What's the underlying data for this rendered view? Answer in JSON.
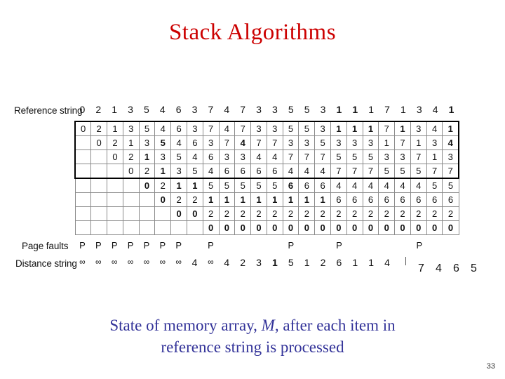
{
  "slide": {
    "title": "Stack Algorithms",
    "page_number": "33",
    "title_color": "#cc0000",
    "caption_color": "#333399"
  },
  "labels": {
    "reference_string": "Reference string",
    "page_faults": "Page faults",
    "distance_string": "Distance string"
  },
  "caption": {
    "line1_part1": "State of memory array, ",
    "line1_italic": "M",
    "line1_part2": ", after each item in",
    "line2": "reference string is processed"
  },
  "chart_data": {
    "type": "table",
    "title": "State of memory array, M, after each item in reference string is processed",
    "columns": 24,
    "reference_string": [
      "0",
      "2",
      "1",
      "3",
      "5",
      "4",
      "6",
      "3",
      "7",
      "4",
      "7",
      "3",
      "3",
      "5",
      "5",
      "3",
      "1",
      "1",
      "1",
      "7",
      "1",
      "3",
      "4",
      "1"
    ],
    "reference_string_bold": [
      false,
      false,
      false,
      false,
      false,
      false,
      false,
      false,
      false,
      false,
      false,
      false,
      false,
      false,
      false,
      false,
      true,
      true,
      false,
      false,
      false,
      false,
      false,
      true
    ],
    "matrix_rows": [
      [
        "0",
        "2",
        "1",
        "3",
        "5",
        "4",
        "6",
        "3",
        "7",
        "4",
        "7",
        "3",
        "3",
        "5",
        "5",
        "3",
        "1",
        "1",
        "1",
        "7",
        "1",
        "3",
        "4",
        "1"
      ],
      [
        "",
        "0",
        "2",
        "1",
        "3",
        "5",
        "4",
        "6",
        "3",
        "7",
        "4",
        "7",
        "7",
        "3",
        "3",
        "5",
        "3",
        "3",
        "3",
        "1",
        "7",
        "1",
        "3",
        "4"
      ],
      [
        "",
        "",
        "0",
        "2",
        "1",
        "3",
        "5",
        "4",
        "6",
        "3",
        "3",
        "4",
        "4",
        "7",
        "7",
        "7",
        "5",
        "5",
        "5",
        "3",
        "3",
        "7",
        "1",
        "3"
      ],
      [
        "",
        "",
        "",
        "0",
        "2",
        "1",
        "3",
        "5",
        "4",
        "6",
        "6",
        "6",
        "6",
        "4",
        "4",
        "4",
        "7",
        "7",
        "7",
        "5",
        "5",
        "5",
        "7",
        "7"
      ],
      [
        "",
        "",
        "",
        "",
        "0",
        "2",
        "1",
        "1",
        "5",
        "5",
        "5",
        "5",
        "5",
        "6",
        "6",
        "6",
        "4",
        "4",
        "4",
        "4",
        "4",
        "4",
        "5",
        "5"
      ],
      [
        "",
        "",
        "",
        "",
        "",
        "0",
        "2",
        "2",
        "1",
        "1",
        "1",
        "1",
        "1",
        "1",
        "1",
        "1",
        "6",
        "6",
        "6",
        "6",
        "6",
        "6",
        "6",
        "6"
      ],
      [
        "",
        "",
        "",
        "",
        "",
        "",
        "0",
        "0",
        "2",
        "2",
        "2",
        "2",
        "2",
        "2",
        "2",
        "2",
        "2",
        "2",
        "2",
        "2",
        "2",
        "2",
        "2",
        "2"
      ],
      [
        "",
        "",
        "",
        "",
        "",
        "",
        "",
        "",
        "0",
        "0",
        "0",
        "0",
        "0",
        "0",
        "0",
        "0",
        "0",
        "0",
        "0",
        "0",
        "0",
        "0",
        "0",
        "0"
      ]
    ],
    "matrix_bold": [
      [
        false,
        false,
        false,
        false,
        false,
        false,
        false,
        false,
        false,
        false,
        false,
        false,
        false,
        false,
        false,
        false,
        true,
        true,
        true,
        false,
        true,
        false,
        false,
        true
      ],
      [
        false,
        false,
        false,
        false,
        false,
        true,
        false,
        false,
        false,
        false,
        true,
        false,
        false,
        false,
        false,
        false,
        false,
        false,
        false,
        false,
        false,
        false,
        false,
        true
      ],
      [
        false,
        false,
        false,
        false,
        true,
        false,
        false,
        false,
        false,
        false,
        false,
        false,
        false,
        false,
        false,
        false,
        false,
        false,
        false,
        false,
        false,
        false,
        false,
        false
      ],
      [
        false,
        false,
        false,
        false,
        false,
        true,
        false,
        false,
        false,
        false,
        false,
        false,
        false,
        false,
        false,
        false,
        false,
        false,
        false,
        false,
        false,
        false,
        false,
        false
      ],
      [
        false,
        false,
        false,
        false,
        true,
        false,
        true,
        true,
        false,
        false,
        false,
        false,
        false,
        true,
        false,
        false,
        false,
        false,
        false,
        false,
        false,
        false,
        false,
        false
      ],
      [
        false,
        false,
        false,
        false,
        false,
        true,
        false,
        false,
        true,
        true,
        true,
        true,
        true,
        true,
        true,
        true,
        false,
        false,
        false,
        false,
        false,
        false,
        false,
        false
      ],
      [
        false,
        false,
        false,
        false,
        false,
        false,
        true,
        true,
        false,
        false,
        false,
        false,
        false,
        false,
        false,
        false,
        false,
        false,
        false,
        false,
        false,
        false,
        false,
        false
      ],
      [
        false,
        false,
        false,
        false,
        false,
        false,
        false,
        false,
        true,
        true,
        true,
        true,
        true,
        true,
        true,
        true,
        true,
        true,
        true,
        true,
        true,
        true,
        true,
        true
      ]
    ],
    "resident_rows": 4,
    "page_faults": [
      "P",
      "P",
      "P",
      "P",
      "P",
      "P",
      "P",
      "",
      "P",
      "",
      "",
      "",
      "",
      "P",
      "",
      "",
      "P",
      "",
      "",
      "",
      "",
      "P",
      "",
      ""
    ],
    "distance_string": [
      "∞",
      "∞",
      "∞",
      "∞",
      "∞",
      "∞",
      "∞",
      "4",
      "∞",
      "4",
      "2",
      "3",
      "1",
      "5",
      "1",
      "2",
      "6",
      "1",
      "1",
      "4",
      "",
      "",
      "",
      ""
    ],
    "distance_string_bold": [
      false,
      false,
      false,
      false,
      false,
      false,
      false,
      false,
      false,
      false,
      false,
      false,
      true,
      false,
      false,
      false,
      false,
      false,
      false,
      false,
      false,
      false,
      false,
      false
    ],
    "distance_overflow": [
      "7",
      "4",
      "6",
      "5"
    ]
  }
}
